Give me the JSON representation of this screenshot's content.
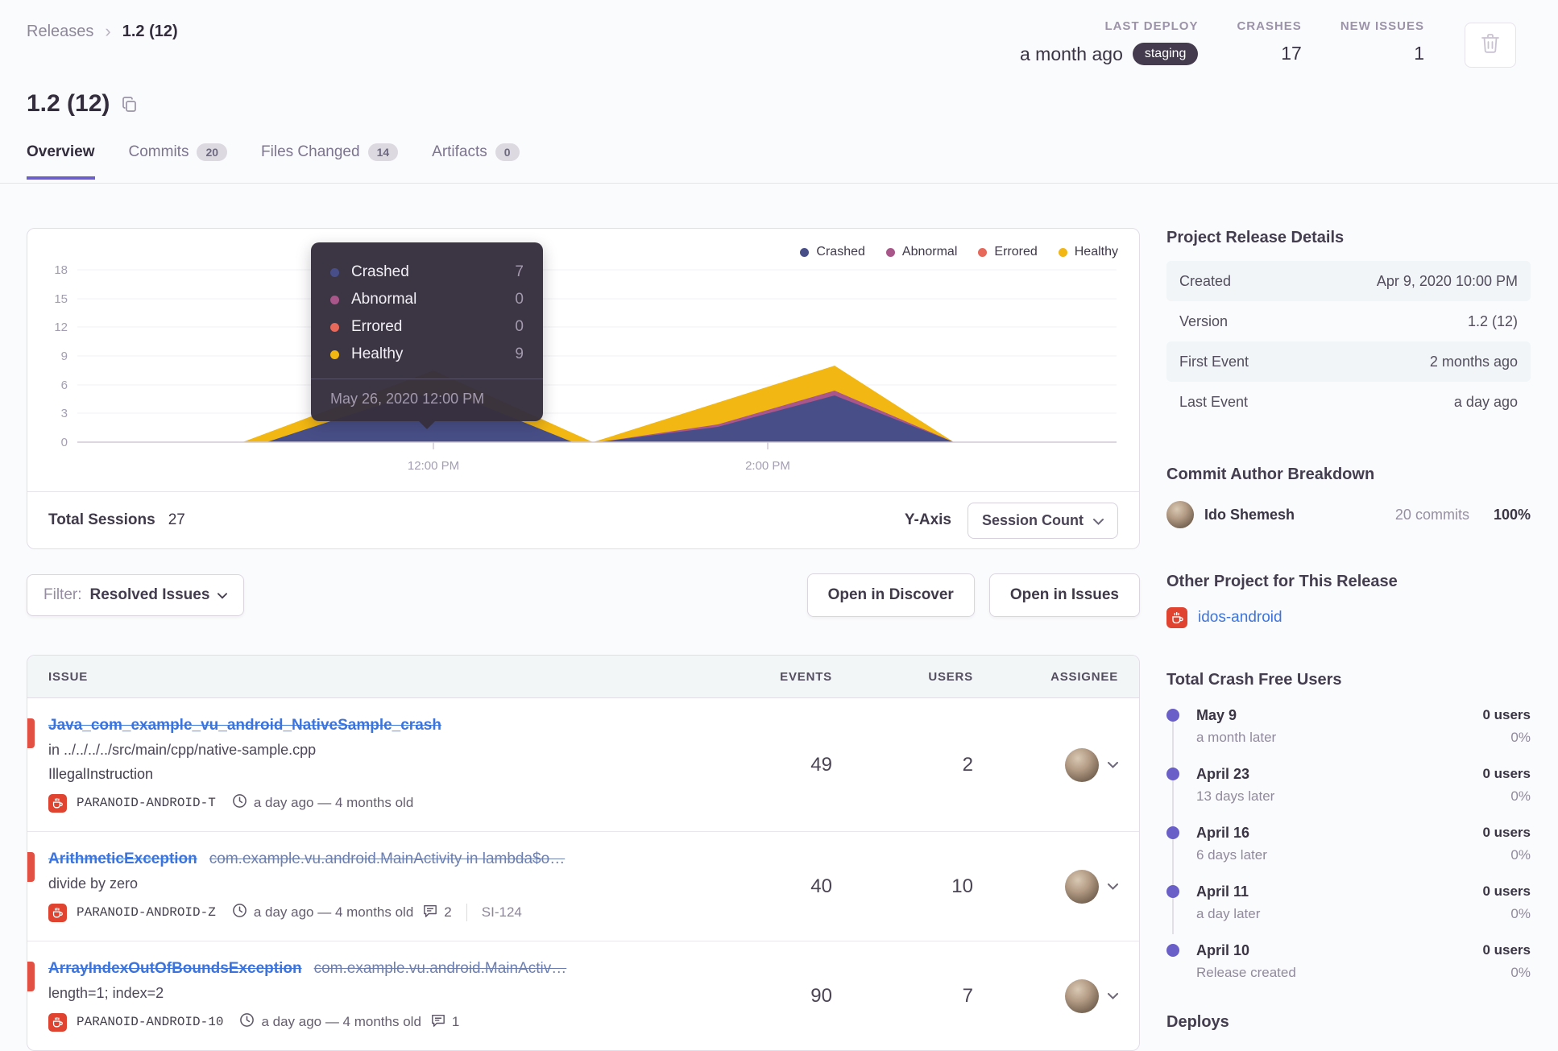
{
  "icons": {
    "breadcrumb_sep": "›",
    "chevron_down": "⌄"
  },
  "accent_color": "#6c5fc7",
  "header": {
    "breadcrumb": {
      "parent": "Releases",
      "current": "1.2 (12)"
    },
    "stats": {
      "last_deploy": {
        "label": "LAST DEPLOY",
        "value": "a month ago",
        "badge": "staging"
      },
      "crashes": {
        "label": "CRASHES",
        "value": "17"
      },
      "new_issues": {
        "label": "NEW ISSUES",
        "value": "1"
      }
    }
  },
  "page_title": "1.2 (12)",
  "tabs": [
    {
      "label": "Overview",
      "active": true
    },
    {
      "label": "Commits",
      "count": "20"
    },
    {
      "label": "Files Changed",
      "count": "14"
    },
    {
      "label": "Artifacts",
      "count": "0"
    }
  ],
  "chart": {
    "legend": [
      "Crashed",
      "Abnormal",
      "Errored",
      "Healthy"
    ],
    "y_ticks": [
      "18",
      "15",
      "12",
      "9",
      "6",
      "3",
      "0"
    ],
    "x_ticks": [
      "12:00 PM",
      "2:00 PM"
    ],
    "tooltip": {
      "rows": [
        {
          "label": "Crashed",
          "value": "7"
        },
        {
          "label": "Abnormal",
          "value": "0"
        },
        {
          "label": "Errored",
          "value": "0"
        },
        {
          "label": "Healthy",
          "value": "9"
        }
      ],
      "date": "May 26, 2020 12:00 PM"
    },
    "footer": {
      "total_label": "Total Sessions",
      "total_value": "27",
      "yaxis_label": "Y-Axis",
      "yaxis_value": "Session Count"
    }
  },
  "chart_data": {
    "type": "area",
    "stacked": true,
    "x": [
      "11:00 AM",
      "12:00 PM",
      "1:00 PM",
      "2:00 PM",
      "2:45 PM",
      "3:30 PM"
    ],
    "series": [
      {
        "name": "Crashed",
        "color": "#484f88",
        "values": [
          0,
          7,
          0,
          3,
          5,
          0
        ]
      },
      {
        "name": "Abnormal",
        "color": "#a9578a",
        "values": [
          0,
          0,
          0,
          0,
          1,
          0
        ]
      },
      {
        "name": "Errored",
        "color": "#e8685a",
        "values": [
          0,
          0,
          0,
          0,
          0,
          0
        ]
      },
      {
        "name": "Healthy",
        "color": "#f2b712",
        "values": [
          0,
          9,
          0,
          4,
          4,
          0
        ]
      }
    ],
    "ylim": [
      0,
      18
    ],
    "y_tick_values": [
      0,
      3,
      6,
      9,
      12,
      15,
      18
    ],
    "x_tick_labels": [
      "12:00 PM",
      "2:00 PM"
    ],
    "grid": true,
    "legend_position": "top-right",
    "highlighted_point": {
      "date": "May 26, 2020 12:00 PM",
      "Crashed": 7,
      "Abnormal": 0,
      "Errored": 0,
      "Healthy": 9
    }
  },
  "filter_bar": {
    "filter_prefix": "Filter:",
    "filter_value": "Resolved Issues",
    "open_discover": "Open in Discover",
    "open_issues": "Open in Issues"
  },
  "issues_table": {
    "columns": {
      "issue": "ISSUE",
      "events": "EVENTS",
      "users": "USERS",
      "assignee": "ASSIGNEE"
    },
    "rows": [
      {
        "title": "Java_com_example_vu_android_NativeSample_crash",
        "culprit": "",
        "line2": "in ../../../../src/main/cpp/native-sample.cpp",
        "line3": "IllegalInstruction",
        "project": "PARANOID-ANDROID-T",
        "age": "a day ago — 4 months old",
        "comments": "",
        "tracker": "",
        "events": "49",
        "users": "2"
      },
      {
        "title": "ArithmeticException",
        "culprit": "com.example.vu.android.MainActivity in lambda$o…",
        "line2": "divide by zero",
        "line3": "",
        "project": "PARANOID-ANDROID-Z",
        "age": "a day ago — 4 months old",
        "comments": "2",
        "tracker": "SI-124",
        "events": "40",
        "users": "10"
      },
      {
        "title": "ArrayIndexOutOfBoundsException",
        "culprit": "com.example.vu.android.MainActiv…",
        "line2": "length=1; index=2",
        "line3": "",
        "project": "PARANOID-ANDROID-10",
        "age": "a day ago — 4 months old",
        "comments": "1",
        "tracker": "",
        "events": "90",
        "users": "7"
      }
    ]
  },
  "sidebar": {
    "details": {
      "heading": "Project Release Details",
      "rows": [
        {
          "label": "Created",
          "value": "Apr 9, 2020 10:00 PM"
        },
        {
          "label": "Version",
          "value": "1.2 (12)"
        },
        {
          "label": "First Event",
          "value": "2 months ago"
        },
        {
          "label": "Last Event",
          "value": "a day ago"
        }
      ]
    },
    "authors": {
      "heading": "Commit Author Breakdown",
      "name": "Ido Shemesh",
      "commits": "20 commits",
      "percent": "100%"
    },
    "other_project": {
      "heading": "Other Project for This Release",
      "link": "idos-android"
    },
    "crash_free": {
      "heading": "Total Crash Free Users",
      "entries": [
        {
          "date": "May 9",
          "sub": "a month later",
          "users": "0 users",
          "pct": "0%"
        },
        {
          "date": "April 23",
          "sub": "13 days later",
          "users": "0 users",
          "pct": "0%"
        },
        {
          "date": "April 16",
          "sub": "6 days later",
          "users": "0 users",
          "pct": "0%"
        },
        {
          "date": "April 11",
          "sub": "a day later",
          "users": "0 users",
          "pct": "0%"
        },
        {
          "date": "April 10",
          "sub": "Release created",
          "users": "0 users",
          "pct": "0%"
        }
      ]
    },
    "deploys_heading": "Deploys"
  }
}
